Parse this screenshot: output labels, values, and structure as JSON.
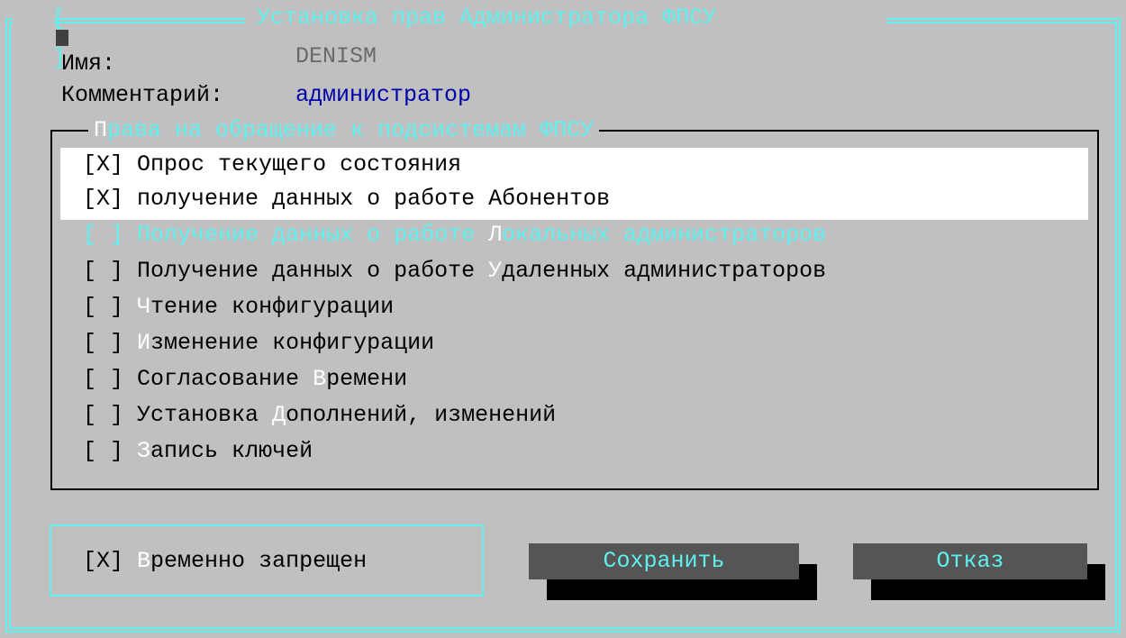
{
  "window": {
    "title": "Установка прав Администратора ФПСУ",
    "close_glyph_left": "[",
    "close_glyph_right": "]"
  },
  "fields": {
    "name_label": "Имя:",
    "name_value": "DENISM",
    "comment_label": "Комментарий:",
    "comment_value": "администратор"
  },
  "group": {
    "title_hot": "П",
    "title_rest": "рава на обращение к подсистемам ФПСУ"
  },
  "rights": [
    {
      "check": "[X]",
      "pre": "",
      "hot": "",
      "post": "Опрос текущего состояния"
    },
    {
      "check": "[X]",
      "pre": "",
      "hot": "",
      "post": "получение данных о работе Абонентов"
    },
    {
      "check": "[ ]",
      "pre": "Получение данных о работе ",
      "hot": "Л",
      "post": "окальных администраторов"
    },
    {
      "check": "[ ]",
      "pre": "Получение данных о работе ",
      "hot": "У",
      "post": "даленных администраторов"
    },
    {
      "check": "[ ]",
      "pre": "",
      "hot": "Ч",
      "post": "тение конфигурации"
    },
    {
      "check": "[ ]",
      "pre": "",
      "hot": "И",
      "post": "зменение конфигурации"
    },
    {
      "check": "[ ]",
      "pre": "Согласование ",
      "hot": "В",
      "post": "ремени"
    },
    {
      "check": "[ ]",
      "pre": "Установка ",
      "hot": "Д",
      "post": "ополнений, изменений"
    },
    {
      "check": "[ ]",
      "pre": "",
      "hot": "З",
      "post": "апись ключей"
    }
  ],
  "blocked": {
    "check": "[X]",
    "hot": "В",
    "post": "ременно запрещен"
  },
  "buttons": {
    "save": "Сохранить",
    "cancel": "Отказ"
  },
  "colors": {
    "background": "#c0c0c0",
    "frame": "#5ff0f0",
    "hotkey": "#ffffff",
    "comment": "#0000aa",
    "button": "#555555"
  }
}
